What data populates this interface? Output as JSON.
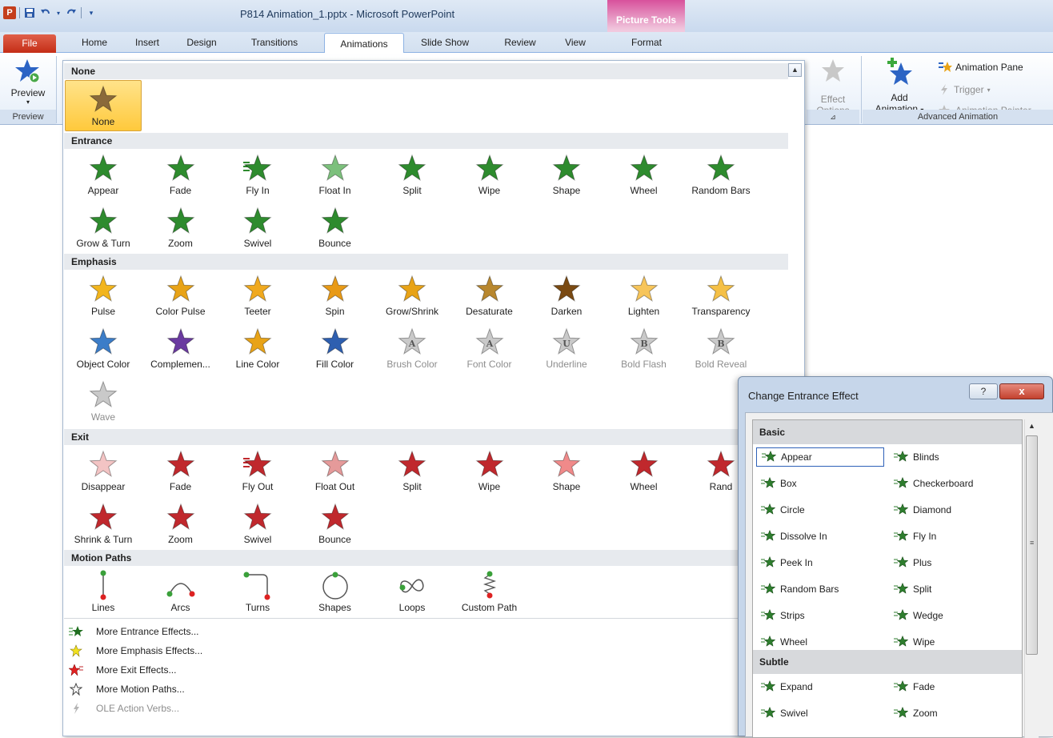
{
  "window": {
    "title": "P814 Animation_1.pptx - Microsoft PowerPoint",
    "app_icon_label": "P",
    "context_tab_group": "Picture Tools"
  },
  "tabs": [
    "File",
    "Home",
    "Insert",
    "Design",
    "Transitions",
    "Animations",
    "Slide Show",
    "Review",
    "View",
    "Format"
  ],
  "ribbon": {
    "preview_button": "Preview",
    "preview_group": "Preview",
    "effect_options": [
      "Effect",
      "Options"
    ],
    "add_animation": [
      "Add",
      "Animation"
    ],
    "animation_pane": "Animation Pane",
    "trigger": "Trigger",
    "animation_painter": "Animation Painter",
    "advanced_group": "Advanced Animation"
  },
  "gallery": {
    "sections": {
      "none": "None",
      "entrance": "Entrance",
      "emphasis": "Emphasis",
      "exit": "Exit",
      "motion": "Motion Paths"
    },
    "none_items": [
      "None"
    ],
    "entrance_items": [
      "Appear",
      "Fade",
      "Fly In",
      "Float In",
      "Split",
      "Wipe",
      "Shape",
      "Wheel",
      "Random Bars",
      "Grow & Turn",
      "Zoom",
      "Swivel",
      "Bounce"
    ],
    "emphasis_items": [
      "Pulse",
      "Color Pulse",
      "Teeter",
      "Spin",
      "Grow/Shrink",
      "Desaturate",
      "Darken",
      "Lighten",
      "Transparency",
      "Object Color",
      "Complemen...",
      "Line Color",
      "Fill Color",
      "Brush Color",
      "Font Color",
      "Underline",
      "Bold Flash",
      "Bold Reveal",
      "Wave"
    ],
    "exit_items": [
      "Disappear",
      "Fade",
      "Fly Out",
      "Float Out",
      "Split",
      "Wipe",
      "Shape",
      "Wheel",
      "Rand",
      "Shrink & Turn",
      "Zoom",
      "Swivel",
      "Bounce"
    ],
    "motion_items": [
      "Lines",
      "Arcs",
      "Turns",
      "Shapes",
      "Loops",
      "Custom Path"
    ],
    "more": [
      "More Entrance Effects...",
      "More Emphasis Effects...",
      "More Exit Effects...",
      "More Motion Paths...",
      "OLE Action Verbs..."
    ]
  },
  "dialog": {
    "title": "Change Entrance Effect",
    "help": "?",
    "close": "x",
    "basic_header": "Basic",
    "basic_items": [
      "Appear",
      "Blinds",
      "Box",
      "Checkerboard",
      "Circle",
      "Diamond",
      "Dissolve In",
      "Fly In",
      "Peek In",
      "Plus",
      "Random Bars",
      "Split",
      "Strips",
      "Wedge",
      "Wheel",
      "Wipe"
    ],
    "subtle_header": "Subtle",
    "subtle_items": [
      "Expand",
      "Fade",
      "Swivel",
      "Zoom"
    ],
    "selected": "Appear"
  },
  "colors": {
    "entrance": "#2e8b2e",
    "emphasis": "#e8a317",
    "exit": "#c0282d",
    "accent": "#2b5ea8",
    "file_tab": "#c42d16",
    "context": "#d8519c"
  }
}
